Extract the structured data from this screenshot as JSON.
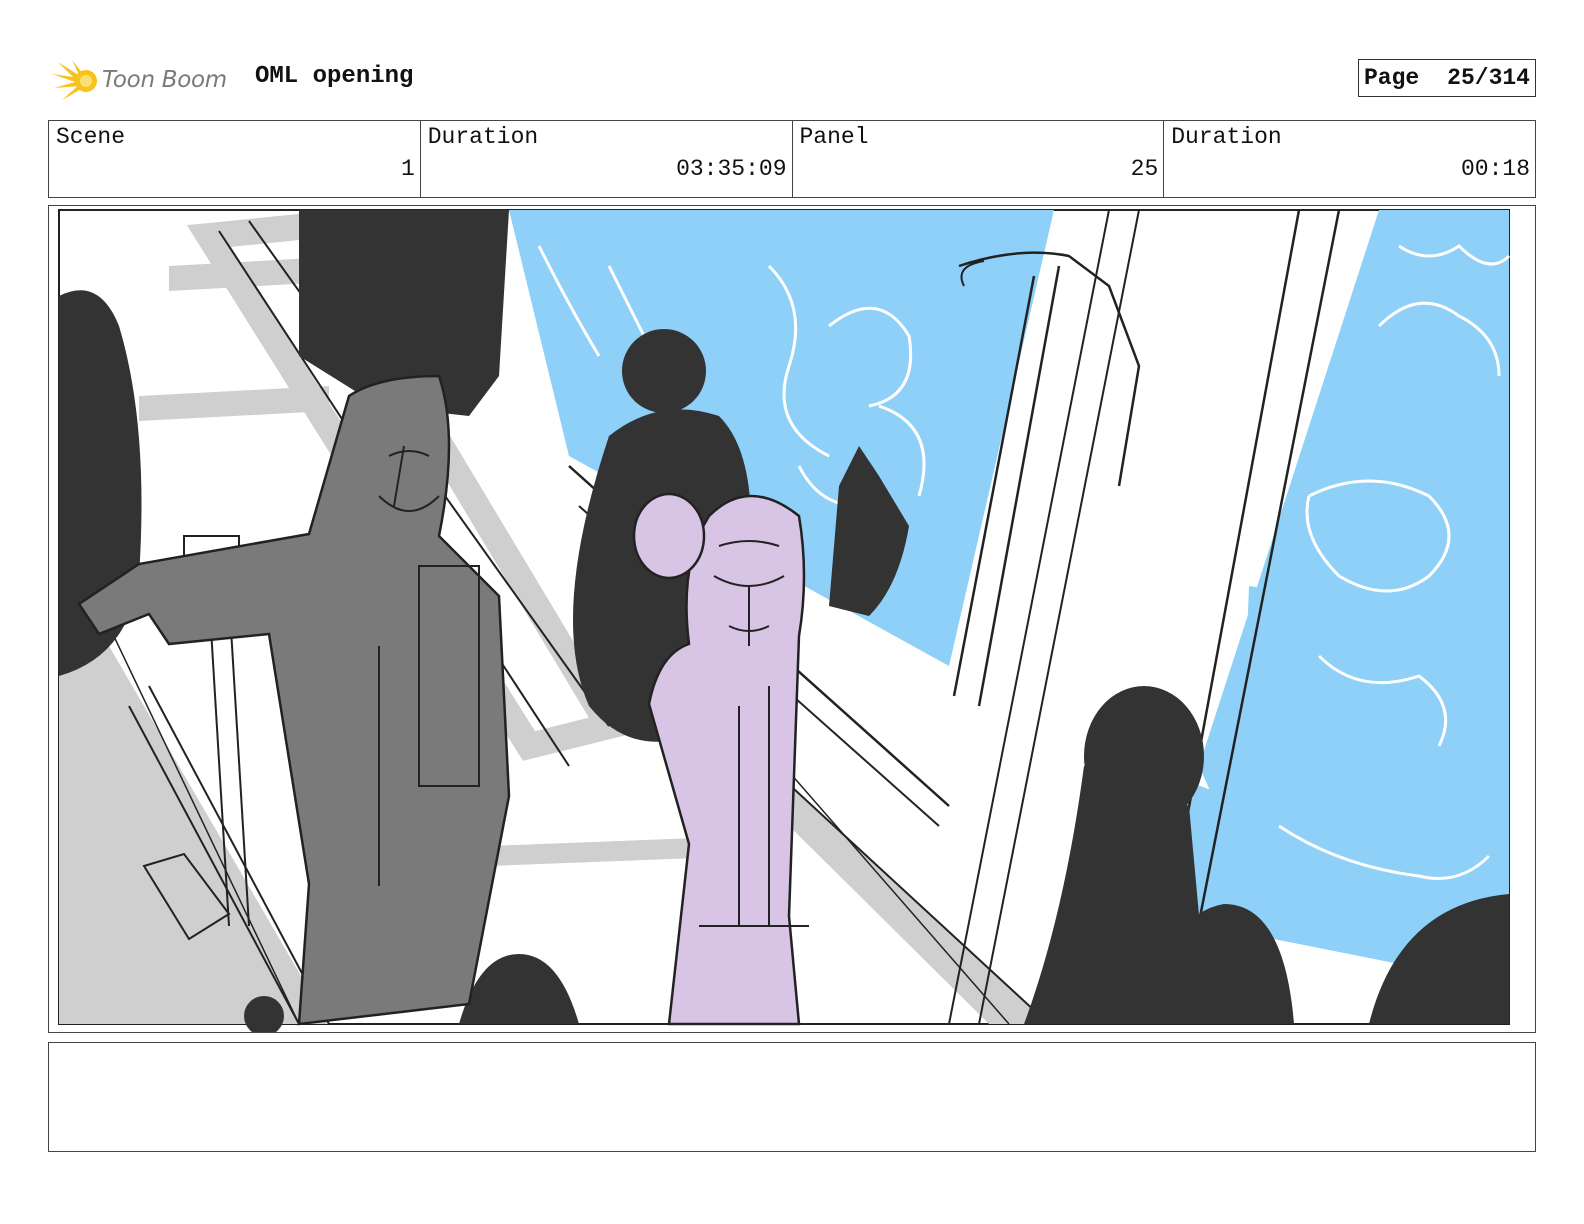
{
  "header": {
    "logo_text": "Toon Boom",
    "project_title": "OML opening",
    "page_label": "Page",
    "page_value": "25/314"
  },
  "info": {
    "scene_label": "Scene",
    "scene_value": "1",
    "scene_duration_label": "Duration",
    "scene_duration_value": "03:35:09",
    "panel_label": "Panel",
    "panel_value": "25",
    "panel_duration_label": "Duration",
    "panel_duration_value": "00:18"
  },
  "colors": {
    "sky_blue": "#8ed0f8",
    "silhouette": "#333333",
    "figure_gray": "#7a7a7a",
    "figure_lilac": "#d8c4e4",
    "logo_yellow": "#f7c21b"
  },
  "notes": {
    "text": ""
  }
}
